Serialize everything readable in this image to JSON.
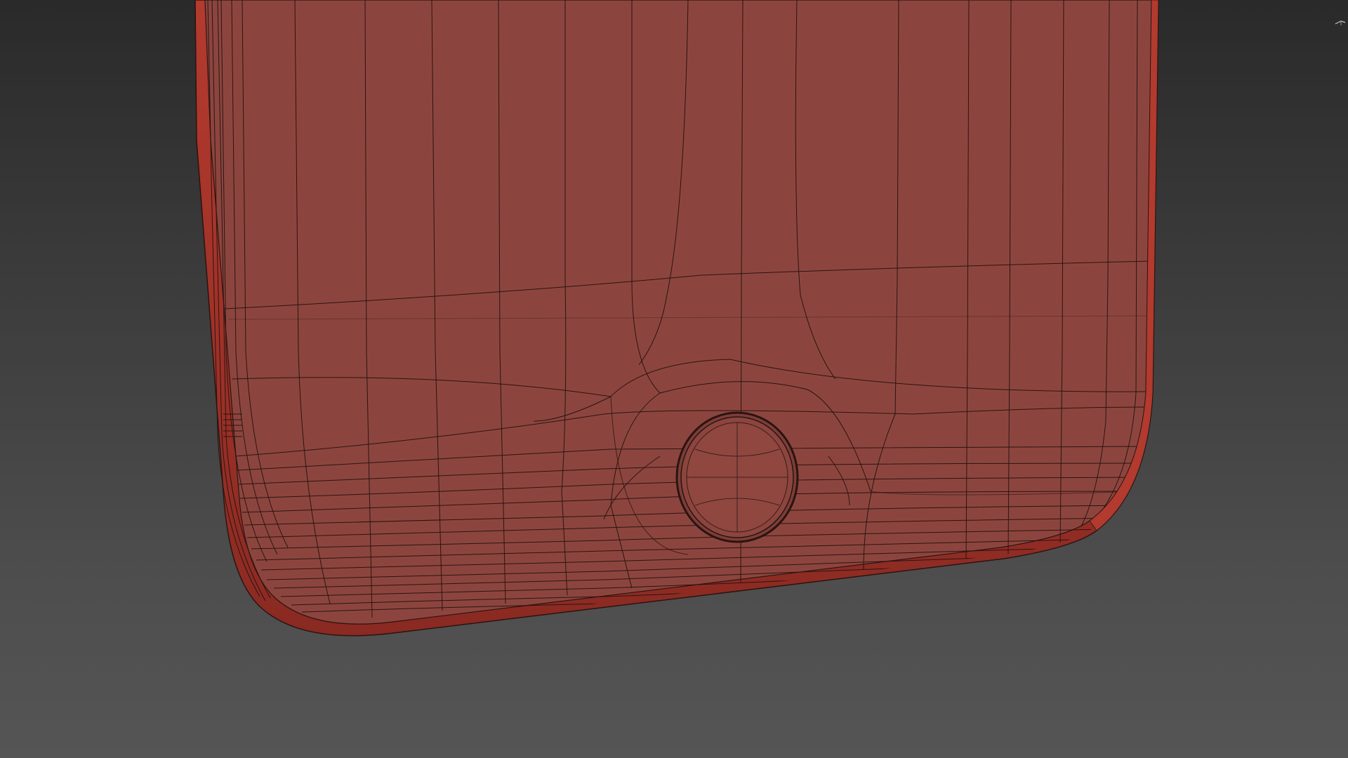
{
  "viewport": {
    "background_top": "#2a2a2a",
    "background_bottom": "#555555",
    "render_mode": "wireframe-on-shaded",
    "object": "phone-body-back-panel",
    "mesh_color": "#8c453e",
    "wire_color": "#2a1412",
    "rim_color": "#b23a2e"
  },
  "overlays": {
    "axis_gizmo_icon": "view-axis-gizmo-icon"
  }
}
